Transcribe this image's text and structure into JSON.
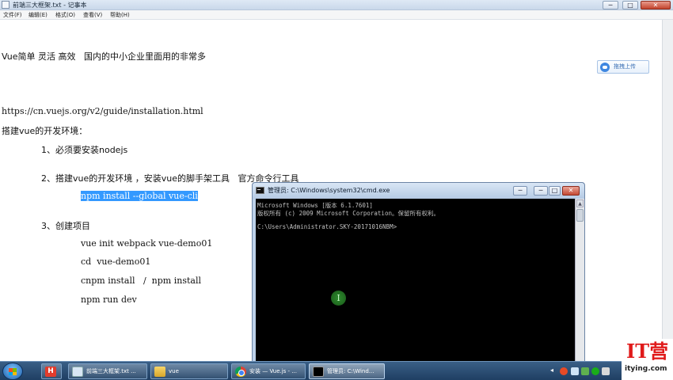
{
  "notepad": {
    "title": "前端三大框架.txt - 记事本",
    "controls": {
      "minimize": "─",
      "maximize": "□",
      "close": "✕"
    },
    "menu": [
      "文件(F)",
      "编辑(E)",
      "格式(O)",
      "查看(V)",
      "帮助(H)"
    ],
    "lines": {
      "l1": "Vue简单 灵活 高效   国内的中小企业里面用的非常多",
      "l2": "https://cn.vuejs.org/v2/guide/installation.html",
      "l3": "搭建vue的开发环境：",
      "l4": "1、必须要安装nodejs",
      "l5": "2、搭建vue的开发环境 ，安装vue的脚手架工具   官方命令行工具",
      "l6": "npm install --global vue-cli",
      "l7": "3、创建项目",
      "l8": "vue init webpack vue-demo01",
      "l9": "cd  vue-demo01",
      "l10": "cnpm install   /  npm install",
      "l11": "npm run dev"
    }
  },
  "upload_button": {
    "label": "拖拽上传"
  },
  "cmd": {
    "title": "管理员: C:\\Windows\\system32\\cmd.exe",
    "controls": {
      "minimize": "─",
      "maximize": "─",
      "restore": "□",
      "close": "✕"
    },
    "lines": [
      "Microsoft Windows [版本 6.1.7601]",
      "版权所有 (c) 2009 Microsoft Corporation。保留所有权利。",
      "",
      "C:\\Users\\Administrator.SKY-20171016NBM>"
    ],
    "cursor_glyph": "I"
  },
  "taskbar": {
    "items": [
      {
        "label": ""
      },
      {
        "label": "前端三大框架.txt ..."
      },
      {
        "label": "vue"
      },
      {
        "label": "安装 — Vue.js - ..."
      },
      {
        "label": "管理员: C:\\Wind..."
      }
    ],
    "hbuilder_glyph": "H",
    "tray_arrow": "◂"
  },
  "logo": {
    "mark": "IT营",
    "url": "itying.com"
  },
  "colors": {
    "selection": "#3399ff",
    "cmd_bg": "#000000",
    "taskbar": "#1f3f63",
    "logo_red": "#e01a1a"
  }
}
